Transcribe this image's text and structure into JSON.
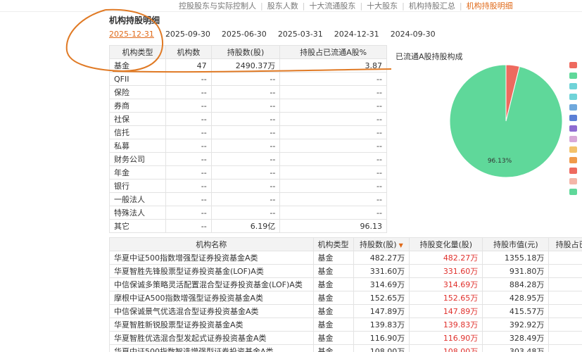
{
  "topnav": {
    "items": [
      {
        "label": "控股股东与实际控制人",
        "active": false
      },
      {
        "label": "股东人数",
        "active": false
      },
      {
        "label": "十大流通股东",
        "active": false
      },
      {
        "label": "十大股东",
        "active": false
      },
      {
        "label": "机构持股汇总",
        "active": false
      },
      {
        "label": "机构持股明细",
        "active": true
      }
    ]
  },
  "section_title": "机构持股明细",
  "date_tabs": [
    {
      "label": "2025-12-31",
      "active": true
    },
    {
      "label": "2025-09-30",
      "active": false
    },
    {
      "label": "2025-06-30",
      "active": false
    },
    {
      "label": "2025-03-31",
      "active": false
    },
    {
      "label": "2024-12-31",
      "active": false
    },
    {
      "label": "2024-09-30",
      "active": false
    }
  ],
  "type_table": {
    "headers": [
      "机构类型",
      "机构数",
      "持股数(股)",
      "持股占已流通A股%"
    ],
    "rows": [
      [
        "基金",
        "47",
        "2490.37万",
        "3.87"
      ],
      [
        "QFII",
        "--",
        "--",
        "--"
      ],
      [
        "保险",
        "--",
        "--",
        "--"
      ],
      [
        "券商",
        "--",
        "--",
        "--"
      ],
      [
        "社保",
        "--",
        "--",
        "--"
      ],
      [
        "信托",
        "--",
        "--",
        "--"
      ],
      [
        "私募",
        "--",
        "--",
        "--"
      ],
      [
        "财务公司",
        "--",
        "--",
        "--"
      ],
      [
        "年金",
        "--",
        "--",
        "--"
      ],
      [
        "银行",
        "--",
        "--",
        "--"
      ],
      [
        "一般法人",
        "--",
        "--",
        "--"
      ],
      [
        "特殊法人",
        "--",
        "--",
        "--"
      ],
      [
        "其它",
        "--",
        "6.19亿",
        "96.13"
      ]
    ]
  },
  "pie": {
    "title": "已流通A股持股构成",
    "label": "96.13%",
    "slices": [
      {
        "value": 3.87,
        "color": "#ee6a5f"
      },
      {
        "value": 96.13,
        "color": "#5fd89a"
      }
    ],
    "legend_colors": [
      "#ee6a5f",
      "#5fd89a",
      "#6fd3d8",
      "#6fd3d8",
      "#6fa8dc",
      "#5b7fd6",
      "#8e6bd1",
      "#d8a8d8",
      "#f3c26b",
      "#f09a4a",
      "#ee6a5f",
      "#f4b6a8",
      "#5fd89a"
    ]
  },
  "detail_table": {
    "headers": [
      "机构名称",
      "机构类型",
      "持股数(股)",
      "持股变化量(股)",
      "持股市值(元)",
      "持股占已流"
    ],
    "sort_icon": "▼",
    "rows": [
      [
        "华夏中证500指数增强型证券投资基金A类",
        "基金",
        "482.27万",
        "482.27万",
        "1355.18万",
        ""
      ],
      [
        "华夏智胜先锋股票型证券投资基金(LOF)A类",
        "基金",
        "331.60万",
        "331.60万",
        "931.80万",
        ""
      ],
      [
        "中信保诚多策略灵活配置混合型证券投资基金(LOF)A类",
        "基金",
        "314.69万",
        "314.69万",
        "884.28万",
        ""
      ],
      [
        "摩根中证A500指数增强型证券投资基金A类",
        "基金",
        "152.65万",
        "152.65万",
        "428.95万",
        ""
      ],
      [
        "中信保诚景气优选混合型证券投资基金A类",
        "基金",
        "147.89万",
        "147.89万",
        "415.57万",
        ""
      ],
      [
        "华夏智胜新锐股票型证券投资基金A类",
        "基金",
        "139.83万",
        "139.83万",
        "392.92万",
        ""
      ],
      [
        "华夏智胜优选混合型发起式证券投资基金A类",
        "基金",
        "116.90万",
        "116.90万",
        "328.49万",
        ""
      ],
      [
        "华夏中证500指数智选增强型证券投资基金A类",
        "基金",
        "108.00万",
        "108.00万",
        "303.48万",
        ""
      ]
    ]
  }
}
